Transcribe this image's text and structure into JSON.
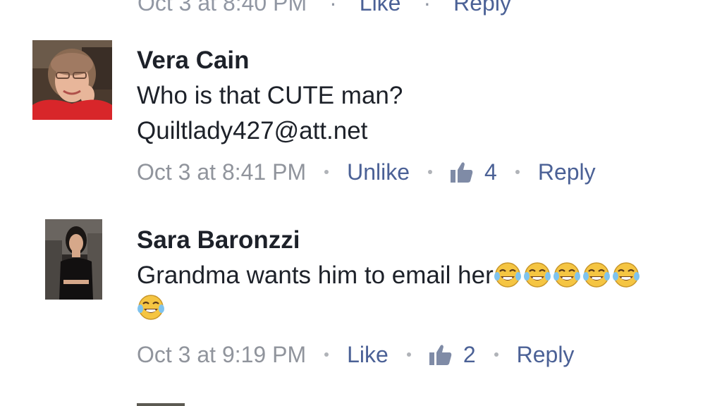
{
  "previous_comment": {
    "timestamp": "Oct 3 at 8:40 PM",
    "like_label": "Like",
    "reply_label": "Reply"
  },
  "comments": [
    {
      "author": "Vera Cain",
      "text_line1": "Who is that CUTE man?",
      "text_line2": "Quiltlady427@att.net",
      "timestamp": "Oct 3 at 8:41 PM",
      "like_action": "Unlike",
      "like_count": "4",
      "reply_label": "Reply"
    },
    {
      "author": "Sara Baronzzi",
      "text": "Grandma wants him to email her",
      "emojis": [
        "tears-of-joy-emoji",
        "tears-of-joy-emoji",
        "tears-of-joy-emoji",
        "tears-of-joy-emoji",
        "tears-of-joy-emoji",
        "tears-of-joy-emoji"
      ],
      "timestamp": "Oct 3 at 9:19 PM",
      "like_action": "Like",
      "like_count": "2",
      "reply_label": "Reply"
    }
  ],
  "colors": {
    "author": "#1d2129",
    "meta": "#90949c",
    "link": "#4b6196",
    "emoji": "#f5c542"
  },
  "icons": {
    "like": "thumbs-up-icon"
  }
}
